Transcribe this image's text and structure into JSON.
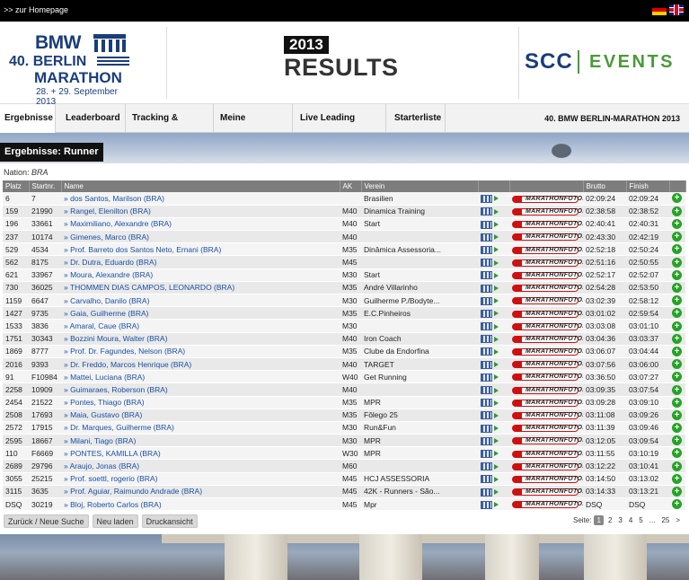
{
  "topbar": {
    "home_link": ">> zur Homepage",
    "flags": [
      "de",
      "en"
    ]
  },
  "header": {
    "bmw_logo": {
      "line1": "BMW",
      "line2": "40. BERLIN",
      "line3": "MARATHON",
      "line4": "28. + 29. September 2013"
    },
    "year": "2013",
    "results": "RESULTS",
    "partner": {
      "scc": "SCC",
      "events": "EVENTS"
    }
  },
  "nav": {
    "tabs": [
      {
        "label": "Ergebnisse",
        "active": true
      },
      {
        "label": "Leaderboard"
      },
      {
        "label": "Tracking & Replay"
      },
      {
        "label": "Meine Favoriten"
      },
      {
        "label": "Live Leading Group"
      },
      {
        "label": "Starterliste"
      }
    ],
    "event_title": "40. BMW BERLIN-MARATHON 2013"
  },
  "section_title": "Ergebnisse: Runner",
  "filter": {
    "label": "Nation:",
    "value": "BRA"
  },
  "table": {
    "columns": [
      "Platz",
      "Startnr.",
      "Name",
      "AK",
      "Verein",
      "",
      "",
      "Brutto",
      "Finish",
      ""
    ],
    "rows": [
      [
        "6",
        "7",
        "» dos Santos, Marilson (BRA)",
        "",
        "Brasilien",
        "02:09:24",
        "02:09:24"
      ],
      [
        "159",
        "21990",
        "» Rangel, Elenilton (BRA)",
        "M40",
        "Dinamica Training",
        "02:38:58",
        "02:38:52"
      ],
      [
        "196",
        "33661",
        "» Maximiliano, Alexandre (BRA)",
        "M40",
        "Start",
        "02:40:41",
        "02:40:31"
      ],
      [
        "237",
        "10174",
        "» Gimenes, Marco (BRA)",
        "M40",
        "",
        "02:43:30",
        "02:42:19"
      ],
      [
        "529",
        "4534",
        "» Prof. Barreto dos Santos Neto, Ernani (BRA)",
        "M35",
        "Dinâmica Assessoria...",
        "02:52:18",
        "02:50:24"
      ],
      [
        "562",
        "8175",
        "» Dr. Dutra, Eduardo (BRA)",
        "M45",
        "",
        "02:51:16",
        "02:50:55"
      ],
      [
        "621",
        "33967",
        "» Moura, Alexandre (BRA)",
        "M30",
        "Start",
        "02:52:17",
        "02:52:07"
      ],
      [
        "730",
        "36025",
        "» THOMMEN DIAS CAMPOS, LEONARDO (BRA)",
        "M35",
        "André Villarinho",
        "02:54:28",
        "02:53:50"
      ],
      [
        "1159",
        "6647",
        "» Carvalho, Danilo (BRA)",
        "M30",
        "Guilherme P./Bodyte...",
        "03:02:39",
        "02:58:12"
      ],
      [
        "1427",
        "9735",
        "» Gaia, Guilherme (BRA)",
        "M35",
        "E.C.Pinheiros",
        "03:01:02",
        "02:59:54"
      ],
      [
        "1533",
        "3836",
        "» Amaral, Caue (BRA)",
        "M30",
        "",
        "03:03:08",
        "03:01:10"
      ],
      [
        "1751",
        "30343",
        "» Bozzini Moura, Walter (BRA)",
        "M40",
        "Iron Coach",
        "03:04:36",
        "03:03:37"
      ],
      [
        "1869",
        "8777",
        "» Prof. Dr. Fagundes, Nelson (BRA)",
        "M35",
        "Clube da Endorfina",
        "03:06:07",
        "03:04:44"
      ],
      [
        "2016",
        "9393",
        "» Dr. Freddo, Marcos Henrique (BRA)",
        "M40",
        "TARGET",
        "03:07:56",
        "03:06:00"
      ],
      [
        "91",
        "F10984",
        "» Mattei, Luciana (BRA)",
        "W40",
        "Get Running",
        "03:36:50",
        "03:07:27"
      ],
      [
        "2258",
        "10909",
        "» Guimaraes, Roberson (BRA)",
        "M40",
        "",
        "03:09:35",
        "03:07:54"
      ],
      [
        "2454",
        "21522",
        "» Pontes, Thiago (BRA)",
        "M35",
        "MPR",
        "03:09:28",
        "03:09:10"
      ],
      [
        "2508",
        "17693",
        "» Maia, Gustavo (BRA)",
        "M35",
        "Fôlego 25",
        "03:11:08",
        "03:09:26"
      ],
      [
        "2572",
        "17915",
        "» Dr. Marques, Guilherme (BRA)",
        "M30",
        "Run&Fun",
        "03:11:39",
        "03:09:46"
      ],
      [
        "2595",
        "18667",
        "» Milani, Tiago (BRA)",
        "M30",
        "MPR",
        "03:12:05",
        "03:09:54"
      ],
      [
        "110",
        "F6669",
        "» PONTES, KAMILLA (BRA)",
        "W30",
        "MPR",
        "03:11:55",
        "03:10:19"
      ],
      [
        "2689",
        "29796",
        "» Araujo, Jonas (BRA)",
        "M60",
        "",
        "03:12:22",
        "03:10:41"
      ],
      [
        "3055",
        "25215",
        "» Prof. soettl, rogerio (BRA)",
        "M45",
        "HCJ ASSESSORIA",
        "03:14:50",
        "03:13:02"
      ],
      [
        "3115",
        "3635",
        "» Prof. Aguiar, Raimundo Andrade (BRA)",
        "M45",
        "42K - Runners - São...",
        "03:14:33",
        "03:13:21"
      ],
      [
        "DSQ",
        "30219",
        "» Bloj, Roberto Carlos (BRA)",
        "M45",
        "Mpr",
        "DSQ",
        "DSQ"
      ]
    ],
    "foto_label": "MARATHONFOTO.com",
    "icons": [
      "video-icon",
      "play-icon",
      "marathonfoto-logo",
      "add-favorite-icon"
    ]
  },
  "buttons": {
    "back": "Zurück / Neue Suche",
    "reload": "Neu laden",
    "print": "Druckansicht"
  },
  "pager": {
    "label": "Seite:",
    "pages": [
      "1",
      "2",
      "3",
      "4",
      "5",
      "...",
      "25",
      ">"
    ],
    "current": "1"
  }
}
